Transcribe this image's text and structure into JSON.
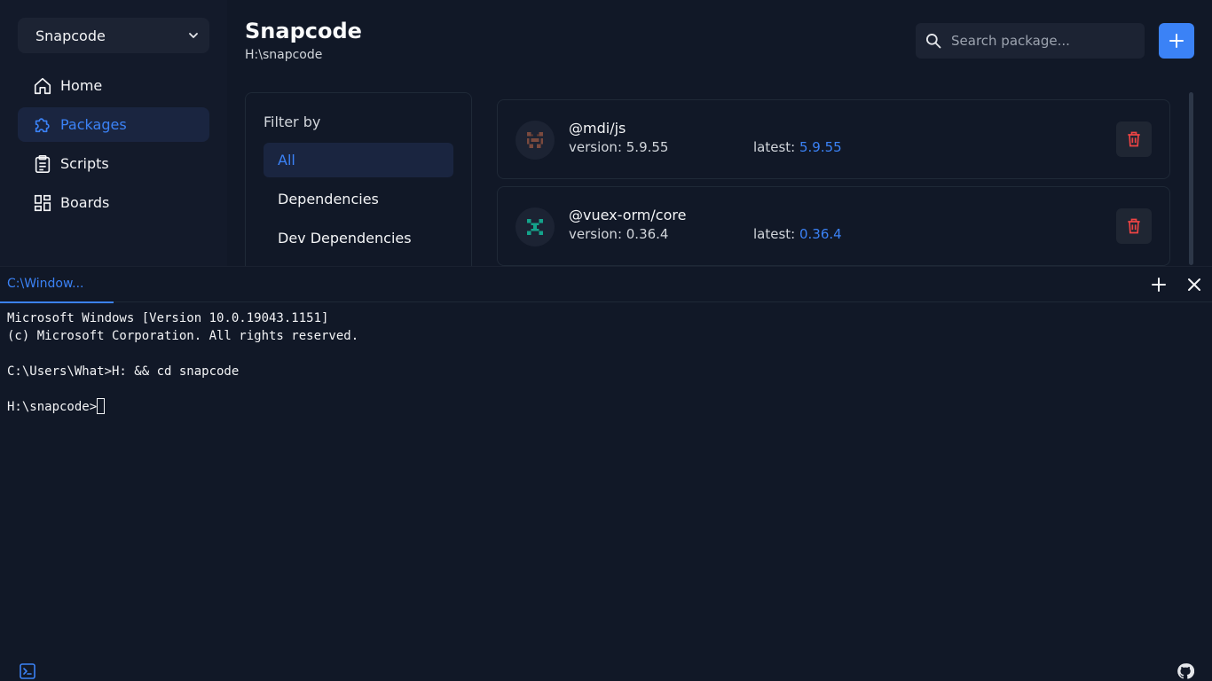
{
  "sidebar": {
    "project": "Snapcode",
    "items": [
      {
        "label": "Home",
        "icon": "home-icon"
      },
      {
        "label": "Packages",
        "icon": "puzzle-icon",
        "active": true
      },
      {
        "label": "Scripts",
        "icon": "clipboard-icon"
      },
      {
        "label": "Boards",
        "icon": "boards-icon"
      }
    ]
  },
  "header": {
    "title": "Snapcode",
    "path": "H:\\snapcode"
  },
  "search": {
    "placeholder": "Search package..."
  },
  "filter": {
    "title": "Filter by",
    "options": [
      "All",
      "Dependencies",
      "Dev Dependencies"
    ],
    "selected": "All"
  },
  "packages": [
    {
      "name": "@mdi/js",
      "version_label": "version: 5.9.55",
      "latest_label": "latest: ",
      "latest": "5.9.55"
    },
    {
      "name": "@vuex-orm/core",
      "version_label": "version: 0.36.4",
      "latest_label": "latest: ",
      "latest": "0.36.4"
    }
  ],
  "terminal": {
    "tab_label": "C:\\Window...",
    "lines": [
      "Microsoft Windows [Version 10.0.19043.1151]",
      "(c) Microsoft Corporation. All rights reserved.",
      "",
      "C:\\Users\\What>H: && cd snapcode",
      "",
      "H:\\snapcode>"
    ]
  },
  "colors": {
    "accent": "#3b82f6",
    "background": "#111827",
    "danger": "#ef4444"
  }
}
